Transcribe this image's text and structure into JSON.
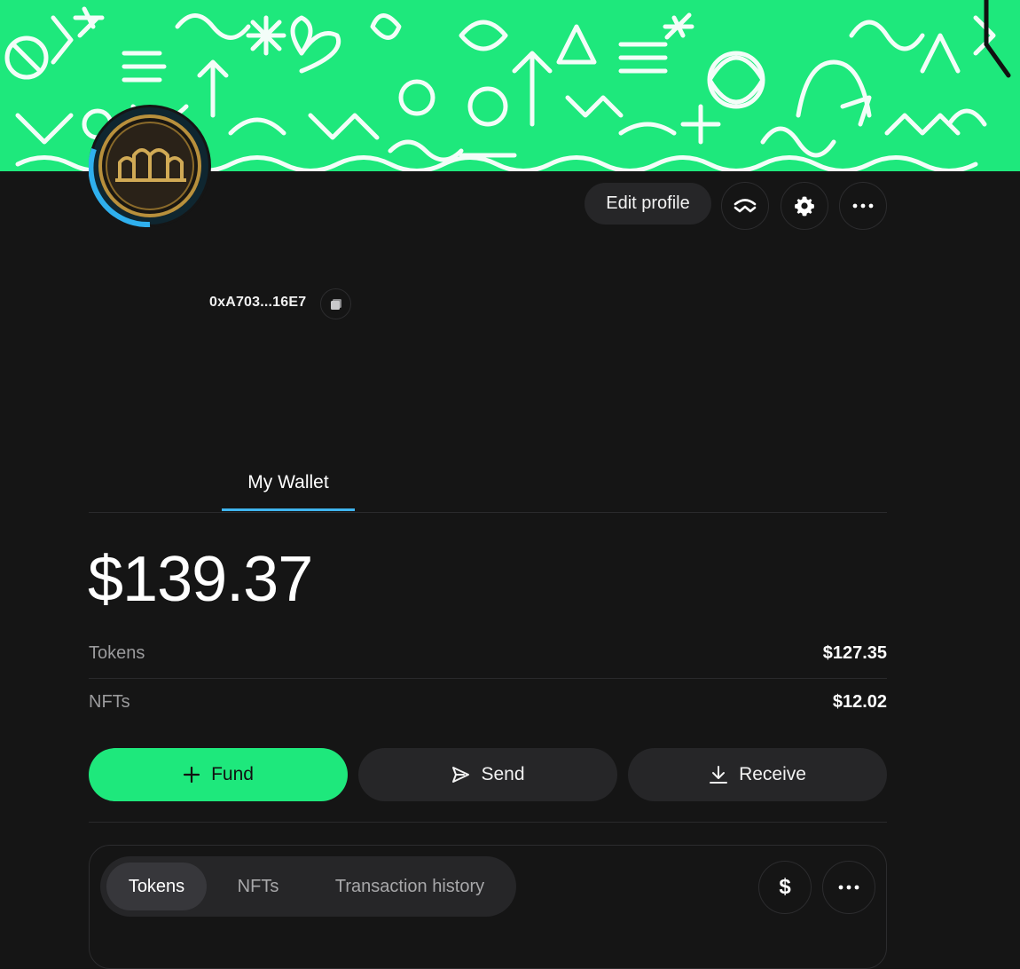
{
  "colors": {
    "banner": "#1ee87c",
    "accent_underline": "#3fb4ee",
    "fund_button": "#1ee87c",
    "background": "#151515"
  },
  "profile": {
    "avatar_icon": "gold-coin-logo-icon",
    "address": "0xA703...16E7",
    "copy_icon": "copy-icon"
  },
  "header_actions": {
    "edit_profile_label": "Edit profile",
    "walletconnect_icon": "walletconnect-icon",
    "settings_icon": "gear-icon",
    "more_icon": "more-icon"
  },
  "tabs": [
    {
      "label": "My Wallet",
      "active": true
    }
  ],
  "wallet": {
    "total": "$139.37",
    "rows": [
      {
        "label": "Tokens",
        "value": "$127.35"
      },
      {
        "label": "NFTs",
        "value": "$12.02"
      }
    ]
  },
  "actions": {
    "fund": "Fund",
    "send": "Send",
    "receive": "Receive"
  },
  "asset_tabs": [
    {
      "label": "Tokens",
      "active": true
    },
    {
      "label": "NFTs",
      "active": false
    },
    {
      "label": "Transaction history",
      "active": false
    }
  ],
  "asset_panel": {
    "currency_symbol": "$",
    "more_icon": "more-icon"
  }
}
